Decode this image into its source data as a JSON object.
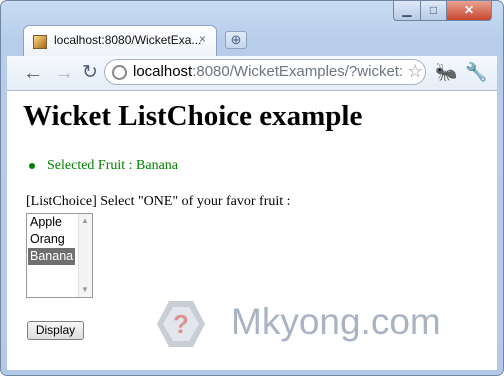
{
  "browser": {
    "tab_title": "localhost:8080/WicketExa...",
    "url_host": "localhost",
    "url_rest": ":8080/WicketExamples/?wicket:",
    "icons": {
      "favicon": "page-favicon-icon",
      "tab_close": "×",
      "new_tab": "⊕",
      "back": "←",
      "forward": "→",
      "reload": "↻",
      "bookmark": "☆",
      "extension": "🐜",
      "wrench": "🔧",
      "minimize": "▁",
      "maximize": "□",
      "close": "✕"
    }
  },
  "page": {
    "heading": "Wicket ListChoice example",
    "selected_text": "Selected Fruit : Banana",
    "prompt": "[ListChoice] Select \"ONE\" of your favor fruit :",
    "list_options": [
      "Apple",
      "Orang",
      "Banana"
    ],
    "selected_option": "Banana",
    "button_label": "Display",
    "watermark_text": "Mkyong.com"
  },
  "colors": {
    "selected_text": "#008000",
    "selected_option_bg": "#6f6f6f",
    "watermark": "#aab3c3"
  }
}
